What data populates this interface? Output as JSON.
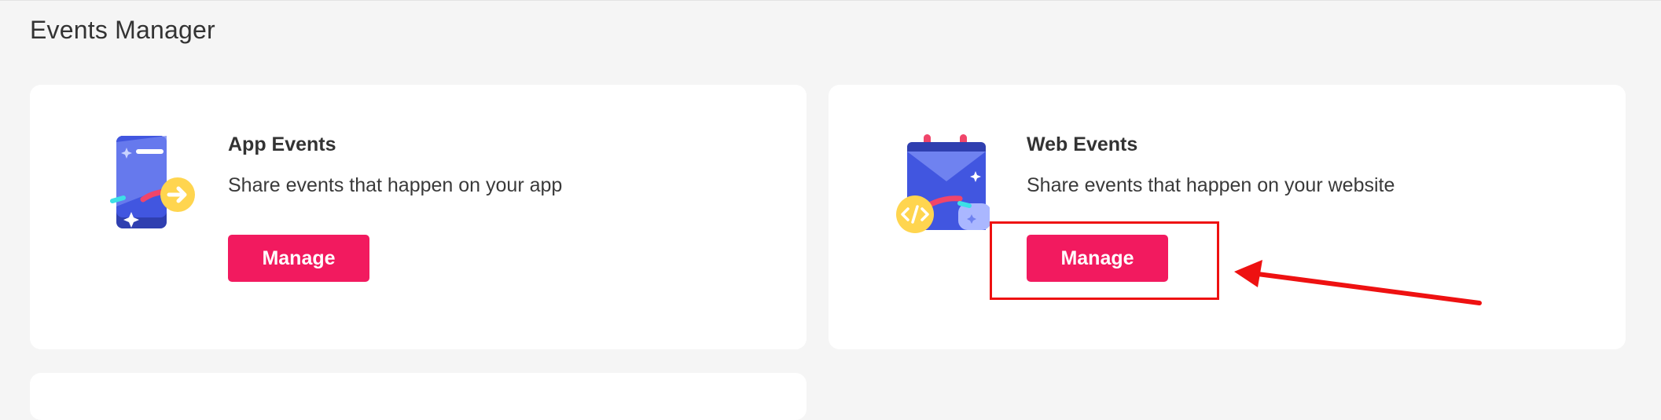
{
  "page": {
    "title": "Events Manager"
  },
  "cards": [
    {
      "icon": "app-phone-arrow-icon",
      "title": "App Events",
      "description": "Share events that happen on your app",
      "button_label": "Manage"
    },
    {
      "icon": "web-calendar-code-icon",
      "title": "Web Events",
      "description": "Share events that happen on your website",
      "button_label": "Manage"
    }
  ],
  "annotation": {
    "highlight_color": "#ee1111",
    "target": "web-events-manage-button"
  },
  "colors": {
    "accent": "#f21a5f",
    "background": "#f5f5f5",
    "card": "#ffffff"
  }
}
